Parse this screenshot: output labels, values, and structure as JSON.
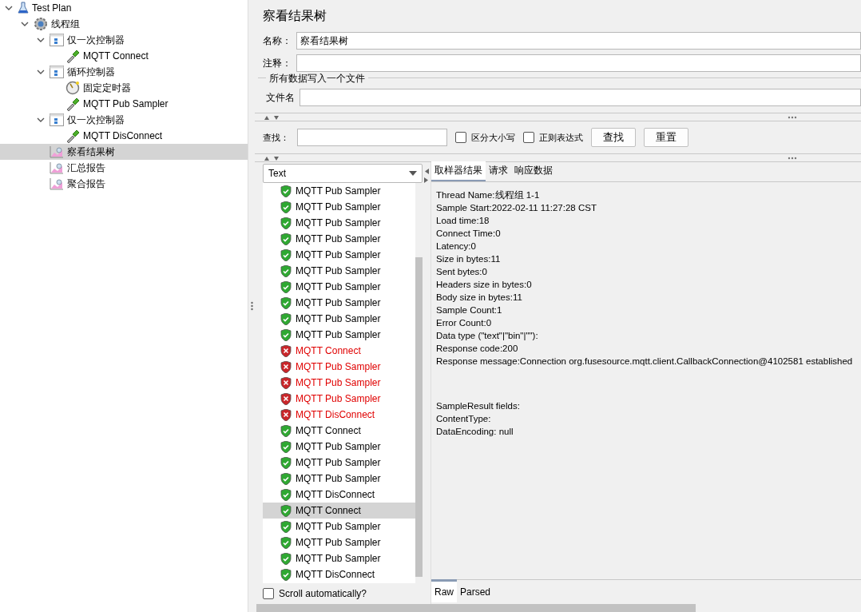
{
  "tree": [
    {
      "label": "Test Plan",
      "kind": "plan",
      "expanded": true,
      "selected": false,
      "children": [
        {
          "label": "线程组",
          "kind": "thread-group",
          "expanded": true,
          "selected": false,
          "children": [
            {
              "label": "仅一次控制器",
              "kind": "controller",
              "expanded": true,
              "selected": false,
              "children": [
                {
                  "label": "MQTT Connect",
                  "kind": "sampler",
                  "selected": false
                }
              ]
            },
            {
              "label": "循环控制器",
              "kind": "controller",
              "expanded": true,
              "selected": false,
              "children": [
                {
                  "label": "固定定时器",
                  "kind": "timer",
                  "selected": false
                },
                {
                  "label": "MQTT Pub Sampler",
                  "kind": "sampler",
                  "selected": false
                }
              ]
            },
            {
              "label": "仅一次控制器",
              "kind": "controller",
              "expanded": true,
              "selected": false,
              "children": [
                {
                  "label": "MQTT DisConnect",
                  "kind": "sampler",
                  "selected": false
                }
              ]
            },
            {
              "label": "察看结果树",
              "kind": "listener",
              "selected": true
            },
            {
              "label": "汇总报告",
              "kind": "listener",
              "selected": false
            },
            {
              "label": "聚合报告",
              "kind": "listener",
              "selected": false
            }
          ]
        }
      ]
    }
  ],
  "title": "察看结果树",
  "name_field": {
    "label": "名称：",
    "value": "察看结果树"
  },
  "comment_field": {
    "label": "注释："
  },
  "file_group": {
    "legend": "所有数据写入一个文件",
    "label": "文件名"
  },
  "search": {
    "label": "查找：",
    "options": [
      {
        "label": "区分大小写",
        "checked": false
      },
      {
        "label": "正则表达式",
        "checked": false
      }
    ],
    "buttons": [
      "查找",
      "重置"
    ]
  },
  "renderer": "Text",
  "results": [
    {
      "label": "MQTT Pub Sampler",
      "success": true,
      "selected": false
    },
    {
      "label": "MQTT Pub Sampler",
      "success": true,
      "selected": false
    },
    {
      "label": "MQTT Pub Sampler",
      "success": true,
      "selected": false
    },
    {
      "label": "MQTT Pub Sampler",
      "success": true,
      "selected": false
    },
    {
      "label": "MQTT Pub Sampler",
      "success": true,
      "selected": false
    },
    {
      "label": "MQTT Pub Sampler",
      "success": true,
      "selected": false
    },
    {
      "label": "MQTT Pub Sampler",
      "success": true,
      "selected": false
    },
    {
      "label": "MQTT Pub Sampler",
      "success": true,
      "selected": false
    },
    {
      "label": "MQTT Pub Sampler",
      "success": true,
      "selected": false
    },
    {
      "label": "MQTT Pub Sampler",
      "success": true,
      "selected": false
    },
    {
      "label": "MQTT Connect",
      "success": false,
      "selected": false
    },
    {
      "label": "MQTT Pub Sampler",
      "success": false,
      "selected": false
    },
    {
      "label": "MQTT Pub Sampler",
      "success": false,
      "selected": false
    },
    {
      "label": "MQTT Pub Sampler",
      "success": false,
      "selected": false
    },
    {
      "label": "MQTT DisConnect",
      "success": false,
      "selected": false
    },
    {
      "label": "MQTT Connect",
      "success": true,
      "selected": false
    },
    {
      "label": "MQTT Pub Sampler",
      "success": true,
      "selected": false
    },
    {
      "label": "MQTT Pub Sampler",
      "success": true,
      "selected": false
    },
    {
      "label": "MQTT Pub Sampler",
      "success": true,
      "selected": false
    },
    {
      "label": "MQTT DisConnect",
      "success": true,
      "selected": false
    },
    {
      "label": "MQTT Connect",
      "success": true,
      "selected": true
    },
    {
      "label": "MQTT Pub Sampler",
      "success": true,
      "selected": false
    },
    {
      "label": "MQTT Pub Sampler",
      "success": true,
      "selected": false
    },
    {
      "label": "MQTT Pub Sampler",
      "success": true,
      "selected": false
    },
    {
      "label": "MQTT DisConnect",
      "success": true,
      "selected": false
    }
  ],
  "scroll_auto": {
    "label": "Scroll automatically?",
    "checked": false
  },
  "detail_tabs": [
    {
      "label": "取样器结果",
      "selected": true
    },
    {
      "label": "请求",
      "selected": false
    },
    {
      "label": "响应数据",
      "selected": false
    }
  ],
  "detail_blocks": [
    [
      "Thread Name:线程组 1-1",
      "Sample Start:2022-02-11 11:27:28 CST",
      "Load time:18",
      "Connect Time:0",
      "Latency:0",
      "Size in bytes:11",
      "Sent bytes:0",
      "Headers size in bytes:0",
      "Body size in bytes:11",
      "Sample Count:1",
      "Error Count:0",
      "Data type (\"text\"|\"bin\"|\"\"):",
      "Response code:200",
      "Response message:Connection org.fusesource.mqtt.client.CallbackConnection@4102581 established"
    ],
    [
      "SampleResult fields:",
      "ContentType:",
      "DataEncoding: null"
    ]
  ],
  "view_tabs": [
    {
      "label": "Raw",
      "selected": true
    },
    {
      "label": "Parsed",
      "selected": false
    }
  ]
}
